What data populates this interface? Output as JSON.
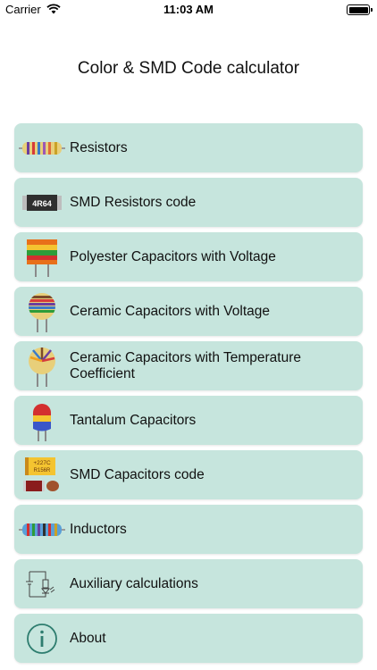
{
  "status_bar": {
    "carrier": "Carrier",
    "time": "11:03 AM"
  },
  "title": "Color & SMD Code calculator",
  "menu": [
    {
      "label": "Resistors",
      "icon": "resistor-icon"
    },
    {
      "label": "SMD Resistors code",
      "icon": "smd-resistor-icon",
      "icon_text": "4R64"
    },
    {
      "label": "Polyester Capacitors with Voltage",
      "icon": "polyester-capacitor-icon"
    },
    {
      "label": "Ceramic Capacitors with Voltage",
      "icon": "ceramic-capacitor-icon"
    },
    {
      "label": "Ceramic Capacitors with Temperature Coefficient",
      "icon": "ceramic-temperature-capacitor-icon"
    },
    {
      "label": "Tantalum Capacitors",
      "icon": "tantalum-capacitor-icon"
    },
    {
      "label": "SMD Capacitors code",
      "icon": "smd-capacitor-icon",
      "icon_text_1": "+227C",
      "icon_text_2": "R156R"
    },
    {
      "label": "Inductors",
      "icon": "inductor-icon"
    },
    {
      "label": "Auxiliary calculations",
      "icon": "circuit-diagram-icon"
    },
    {
      "label": "About",
      "icon": "info-icon"
    }
  ],
  "colors": {
    "item_background": "#c6e5dd",
    "info_icon": "#2e7d6f"
  }
}
